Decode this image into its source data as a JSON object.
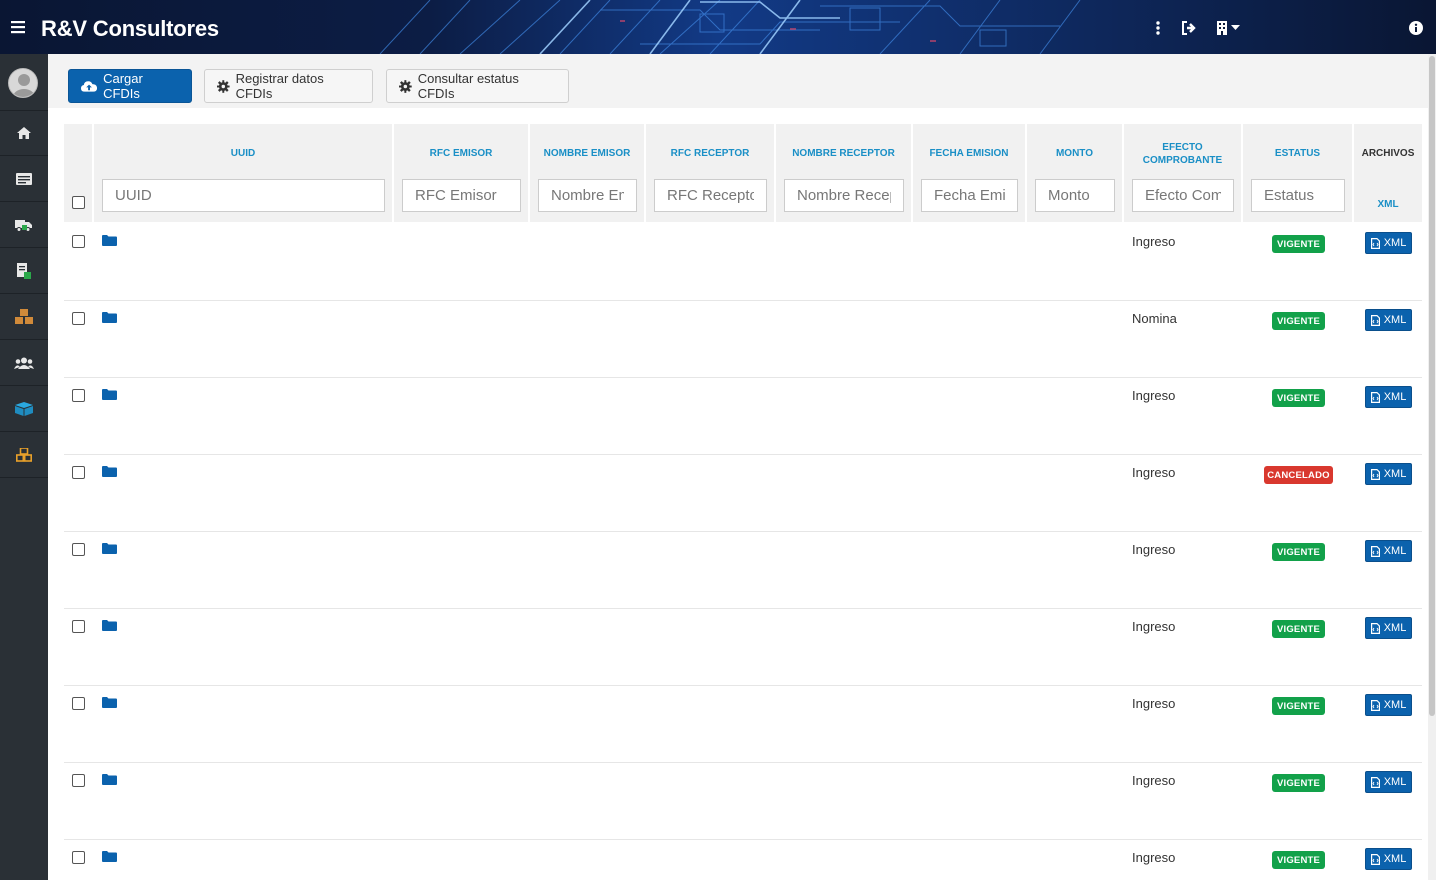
{
  "header": {
    "title": "R&V Consultores",
    "icons": [
      "hamburger-menu-icon",
      "vertical-dots-icon",
      "sign-out-icon",
      "building-dropdown-icon",
      "info-icon"
    ]
  },
  "sidebar": {
    "items": [
      "home-icon",
      "list-icon",
      "truck-icon",
      "xml-file-icon",
      "cubes-icon",
      "users-icon",
      "boxes-icon",
      "cubes-orange-icon"
    ]
  },
  "toolbar": {
    "cargar_label": "Cargar CFDIs",
    "registrar_label": "Registrar datos CFDIs",
    "consultar_label": "Consultar estatus CFDIs"
  },
  "table": {
    "columns": {
      "uuid": "UUID",
      "rfc_emisor": "RFC EMISOR",
      "nombre_emisor": "NOMBRE EMISOR",
      "rfc_receptor": "RFC RECEPTOR",
      "nombre_receptor": "NOMBRE RECEPTOR",
      "fecha_emision": "FECHA EMISION",
      "monto": "MONTO",
      "efecto_line1": "EFECTO",
      "efecto_line2": "COMPROBANTE",
      "estatus": "ESTATUS",
      "archivos": "ARCHIVOS",
      "archivos_sub": "XML"
    },
    "filters": {
      "uuid": "UUID",
      "rfc_emisor": "RFC Emisor",
      "nombre_emisor": "Nombre Emisor",
      "rfc_receptor": "RFC Receptor",
      "nombre_receptor": "Nombre Receptor",
      "fecha_emision": "Fecha Emision",
      "monto": "Monto",
      "efecto": "Efecto Comprobante",
      "estatus": "Estatus"
    },
    "rows": [
      {
        "efecto": "Ingreso",
        "estatus": "VIGENTE",
        "xml": "XML"
      },
      {
        "efecto": "Nomina",
        "estatus": "VIGENTE",
        "xml": "XML"
      },
      {
        "efecto": "Ingreso",
        "estatus": "VIGENTE",
        "xml": "XML"
      },
      {
        "efecto": "Ingreso",
        "estatus": "CANCELADO",
        "xml": "XML"
      },
      {
        "efecto": "Ingreso",
        "estatus": "VIGENTE",
        "xml": "XML"
      },
      {
        "efecto": "Ingreso",
        "estatus": "VIGENTE",
        "xml": "XML"
      },
      {
        "efecto": "Ingreso",
        "estatus": "VIGENTE",
        "xml": "XML"
      },
      {
        "efecto": "Ingreso",
        "estatus": "VIGENTE",
        "xml": "XML"
      },
      {
        "efecto": "Ingreso",
        "estatus": "VIGENTE",
        "xml": "XML"
      }
    ]
  },
  "colors": {
    "primary": "#0b62ad",
    "header_text": "#1a8fc6",
    "vigente": "#12a14a",
    "cancelado": "#d9382e",
    "sidebar": "#2a3036"
  }
}
